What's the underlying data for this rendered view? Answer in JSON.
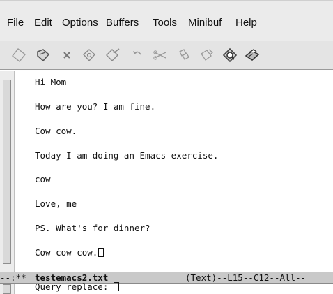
{
  "menubar": {
    "items": [
      {
        "label": "File"
      },
      {
        "label": "Edit"
      },
      {
        "label": "Options"
      },
      {
        "label": "Buffers"
      },
      {
        "label": "Tools"
      },
      {
        "label": "Minibuf"
      },
      {
        "label": "Help"
      }
    ]
  },
  "toolbar": {
    "buttons": [
      {
        "icon": "new-file-icon"
      },
      {
        "icon": "open-folder-icon"
      },
      {
        "icon": "close-x-icon"
      },
      {
        "icon": "save-icon"
      },
      {
        "icon": "save-as-icon"
      },
      {
        "icon": "undo-icon"
      },
      {
        "icon": "cut-icon"
      },
      {
        "icon": "copy-icon"
      },
      {
        "icon": "paste-icon"
      },
      {
        "icon": "search-icon"
      },
      {
        "icon": "print-icon"
      }
    ]
  },
  "buffer": {
    "lines": [
      "Hi Mom",
      "How are you? I am fine.",
      "Cow cow.",
      "Today I am doing an Emacs exercise.",
      "cow",
      "Love, me",
      "PS. What's for dinner?",
      "Cow cow cow."
    ]
  },
  "modeline": {
    "status": "--:**",
    "buffer_name": "testemacs2.txt",
    "info": "(Text)--L15--C12--All--"
  },
  "minibuffer": {
    "prompt": "Query replace: "
  },
  "colors": {
    "menubar_bg": "#ebebeb",
    "toolbar_bg": "#e4e4e4",
    "modeline_bg": "#c9c9c9"
  }
}
